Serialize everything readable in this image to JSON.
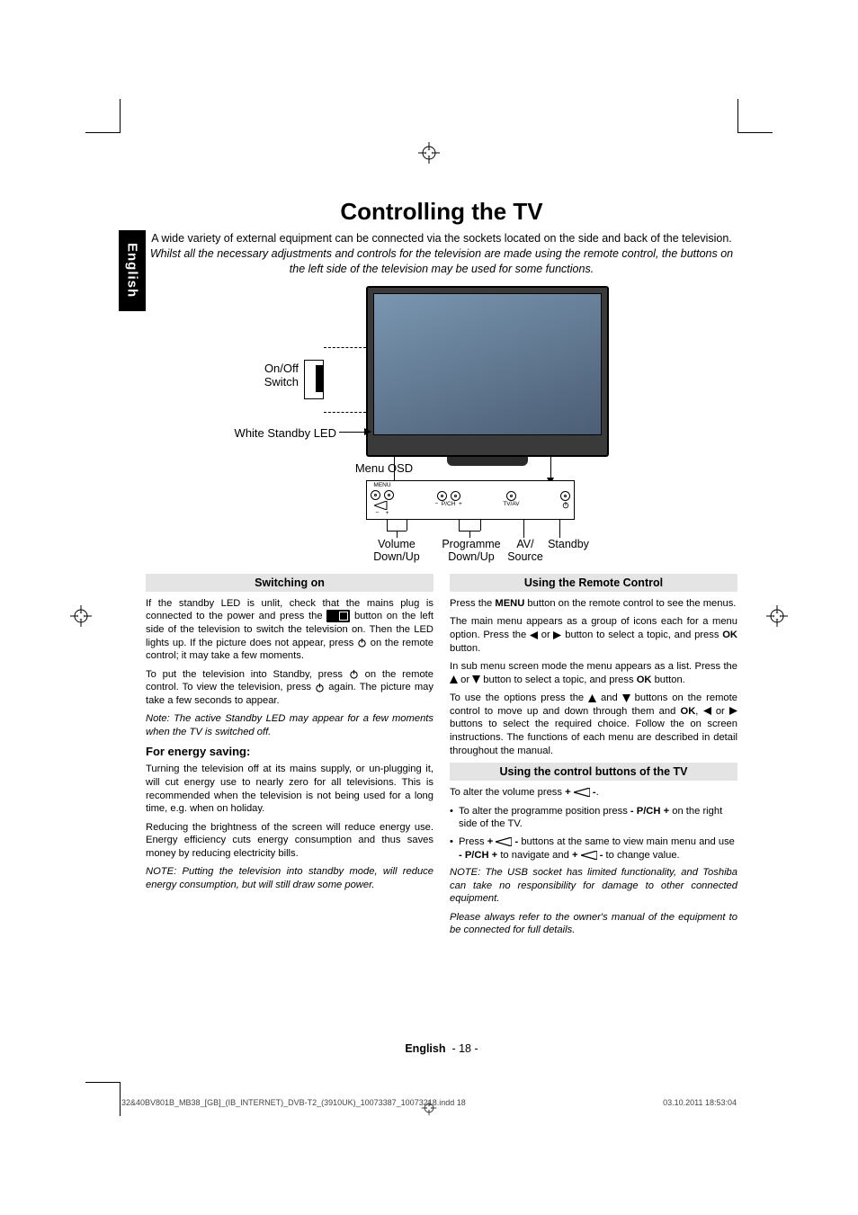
{
  "langTab": "English",
  "title": "Controlling the TV",
  "intro_plain": "A wide variety of external equipment can be connected via the sockets located on the side and back of the television. ",
  "intro_italic": "Whilst all the necessary adjustments and controls for the television are made using the remote control, the buttons on the left side of the television may be used for some functions.",
  "diagram": {
    "onoff": "On/Off\nSwitch",
    "standby_led": "White Standby LED",
    "menu_osd": "Menu OSD",
    "volume": "Volume\nDown/Up",
    "programme": "Programme\nDown/Up",
    "av": "AV/\nSource",
    "standby": "Standby",
    "panel_menu": "MENU",
    "panel_pch": "P/CH",
    "panel_tvav": "TV/AV"
  },
  "left": {
    "bar1": "Switching on",
    "p1a": "If the standby LED is unlit, check that the mains plug is connected to the power and press the ",
    "p1b": " button on the left side of the television to switch the television on. Then the LED lights up. If the picture does not appear, press ",
    "p1c": " on the remote control; it may take a few moments.",
    "p2a": "To put the television into Standby, press ",
    "p2b": " on the remote control. To view the television, press ",
    "p2c": " again. The picture may take a few seconds to appear.",
    "note1": "Note: The active Standby LED may appear for a few moments when the TV is switched off.",
    "h3": "For energy saving:",
    "p3": "Turning the television off at its mains supply, or un-plugging it, will cut energy use to nearly zero for all televisions. This is recommended when the television is not being used for a long time, e.g. when on holiday.",
    "p4": "Reducing the brightness of the screen will reduce energy use. Energy efficiency cuts energy consumption and thus saves money by reducing electricity bills.",
    "note2": "NOTE: Putting the television into standby mode, will reduce energy consumption, but will still draw some power."
  },
  "right": {
    "bar1": "Using the Remote Control",
    "p1a": "Press the ",
    "p1b": "MENU",
    "p1c": " button on the remote control to see the menus.",
    "p2a": "The main menu appears as a group of icons each for a menu option. Press the ",
    "p2b": " or ",
    "p2c": " button to select a topic, and press ",
    "p2d": "OK",
    "p2e": " button.",
    "p3a": "In sub menu screen mode the menu appears as a list. Press the ",
    "p3b": " or ",
    "p3c": " button to select a topic, and press ",
    "p3d": "OK",
    "p3e": " button.",
    "p4a": "To use the options press the ",
    "p4b": " and ",
    "p4c": " buttons on the remote control to move up and down through them and ",
    "p4d": "OK",
    "p4e": ", ",
    "p4f": " or ",
    "p4g": " buttons to select the required choice. Follow the on screen instructions. The functions of each menu are described in detail throughout the manual.",
    "bar2": "Using the control buttons of the TV",
    "p5a": "To alter the volume press ",
    "p5b": "+ ",
    "p5c": " -",
    "p5d": ".",
    "b1a": "To alter the programme position press ",
    "b1b": "- P/CH +",
    "b1c": " on the right side of the TV.",
    "b2a": "Press ",
    "b2b": "+ ",
    "b2c": " -",
    "b2d": " buttons at the same to view main menu and use ",
    "b2e": "- P/CH +",
    "b2f": " to navigate and ",
    "b2g": "+ ",
    "b2h": " -",
    "b2i": " to change value.",
    "note1": "NOTE: The USB socket has limited functionality, and Toshiba can take no responsibility for damage to other connected equipment.",
    "note2": "Please always refer to the owner's manual of the equipment to be connected for full details."
  },
  "footer": {
    "lang": "English",
    "page": "- 18 -"
  },
  "imprint": {
    "left": "32&40BV801B_MB38_[GB]_(IB_INTERNET)_DVB-T2_(3910UK)_10073387_10073218.indd   18",
    "right": "03.10.2011   18:53:04"
  }
}
